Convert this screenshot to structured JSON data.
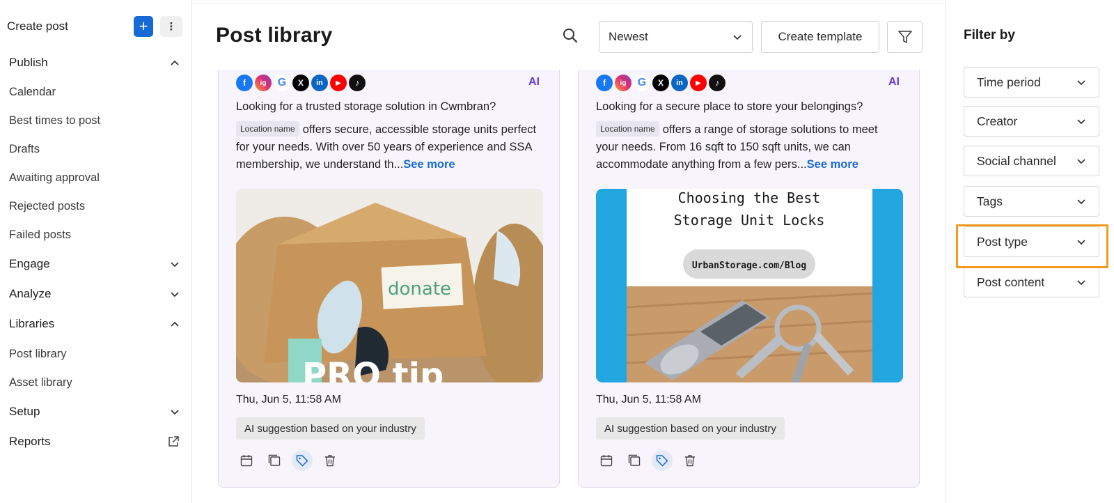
{
  "sidebar": {
    "create_label": "Create post",
    "plus_label": "+",
    "more_label": "⋮",
    "sections": [
      {
        "label": "Publish",
        "expanded": true
      },
      {
        "label": "Engage",
        "expanded": false
      },
      {
        "label": "Analyze",
        "expanded": false
      },
      {
        "label": "Libraries",
        "expanded": true
      },
      {
        "label": "Setup",
        "expanded": false
      },
      {
        "label": "Reports",
        "external": true
      }
    ],
    "publish_items": [
      "Calendar",
      "Best times to post",
      "Drafts",
      "Awaiting approval",
      "Rejected posts",
      "Failed posts"
    ],
    "library_items": [
      "Post library",
      "Asset library"
    ]
  },
  "header": {
    "title": "Post library",
    "sort_value": "Newest",
    "create_template_label": "Create template"
  },
  "posts": [
    {
      "socials": [
        "f",
        "ig",
        "G",
        "X",
        "in",
        "▶",
        "♪"
      ],
      "ai_badge": "AI",
      "line1": "Looking for a trusted storage solution in Cwmbran?",
      "location_tag": "Location name",
      "line2": "offers secure, accessible storage units perfect for your needs. With over 50 years of experience and SSA membership, we understand th...",
      "see_more": "See more",
      "image_text": "PRO tip",
      "image_box_label": "donate",
      "date": "Thu, Jun 5, 11:58 AM",
      "ai_suggestion": "AI suggestion based on your industry"
    },
    {
      "socials": [
        "f",
        "ig",
        "G",
        "X",
        "in",
        "▶",
        "♪"
      ],
      "ai_badge": "AI",
      "line1": "Looking for a secure place to store your belongings?",
      "location_tag": "Location name",
      "line2": "offers a range of storage solutions to meet your needs. From 16 sqft to 150 sqft units, we can accommodate anything from a few pers...",
      "see_more": "See more",
      "image_title_1": "Choosing the Best",
      "image_title_2": "Storage Unit Locks",
      "image_url": "UrbanStorage.com/Blog",
      "date": "Thu, Jun 5, 11:58 AM",
      "ai_suggestion": "AI suggestion based on your industry"
    }
  ],
  "filters": {
    "title": "Filter by",
    "items": [
      "Time period",
      "Creator",
      "Social channel",
      "Tags",
      "Post type",
      "Post content"
    ],
    "highlighted": "Post type"
  },
  "colors": {
    "accent": "#1769d6",
    "highlight": "#f39a1e",
    "card_bg": "#f7f5fb",
    "ai_purple": "#6a3bd6"
  }
}
